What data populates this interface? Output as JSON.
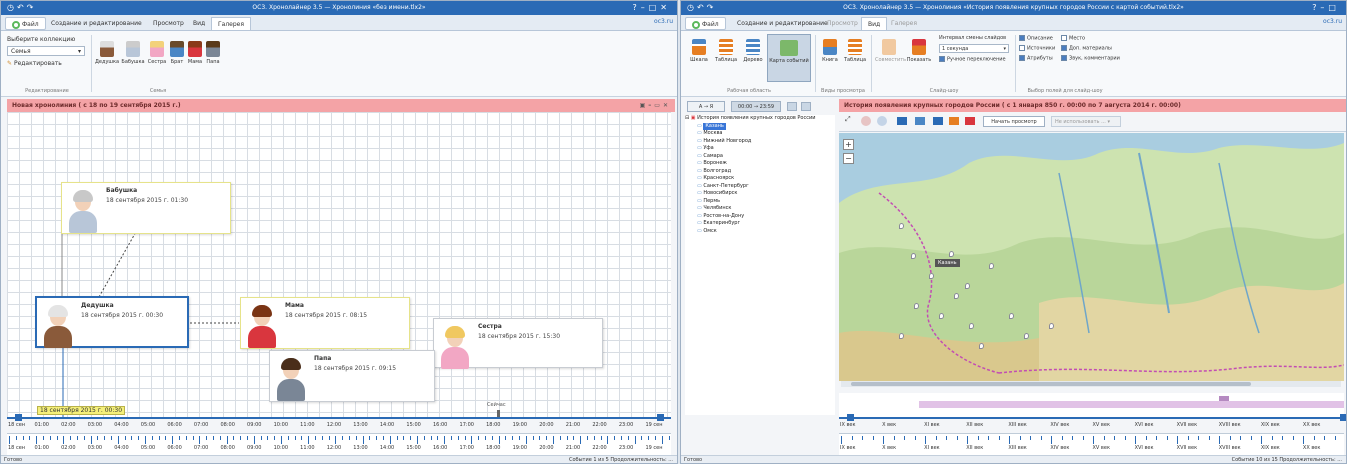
{
  "left": {
    "title": "ОС3. Хронолайнер 3.5 — Хронолиния «без имени.tlx2»",
    "site": "oc3.ru",
    "tabs": [
      "Файл",
      "Создание и редактирование",
      "Просмотр",
      "Вид",
      "Галерея"
    ],
    "ribbon": {
      "collection_label": "Выберите коллекцию",
      "collection_value": "Семья",
      "edit_label": "Редактировать",
      "group_edit": "Редактирование",
      "group_family": "Семья",
      "family_buttons": [
        "Дедушка",
        "Бабушка",
        "Сестра",
        "Брат",
        "Мама",
        "Папа"
      ]
    },
    "chrono_title": "Новая хронолиния ( с 18 по 19 сентября 2015 г.)",
    "cards": [
      {
        "name": "Бабушка",
        "date": "18 сентября 2015 г. 01:30"
      },
      {
        "name": "Дедушка",
        "date": "18 сентября 2015 г. 00:30"
      },
      {
        "name": "Мама",
        "date": "18 сентября 2015 г. 08:15"
      },
      {
        "name": "Сестра",
        "date": "18 сентября 2015 г. 15:30"
      },
      {
        "name": "Папа",
        "date": "18 сентября 2015 г. 09:15"
      }
    ],
    "cursor_date": "18 сентября 2015 г. 00:30",
    "now_label": "Сейчас",
    "axis": [
      "18 сен",
      "01:00",
      "02:00",
      "03:00",
      "04:00",
      "05:00",
      "06:00",
      "07:00",
      "08:00",
      "09:00",
      "10:00",
      "11:00",
      "12:00",
      "13:00",
      "14:00",
      "15:00",
      "16:00",
      "17:00",
      "18:00",
      "19:00",
      "20:00",
      "21:00",
      "22:00",
      "23:00",
      "19 сен"
    ],
    "status_left": "Готово",
    "status_right": "Событие 1 из 5  Продолжительность: ..."
  },
  "right": {
    "title": "ОС3. Хронолайнер 3.5 — Хронолиния «История появления крупных городов России с картой событий.tlx2»",
    "site": "oc3.ru",
    "tabs": [
      "Файл",
      "Создание и редактирование",
      "Просмотр",
      "Вид",
      "Галерея"
    ],
    "ribbon": {
      "work_buttons": [
        "Шкала",
        "Таблица",
        "Дерево",
        "Карта событий"
      ],
      "group_work": "Рабочая область",
      "view_buttons": [
        "Книга",
        "Таблица",
        "Совместить",
        "Показать"
      ],
      "group_views": "Виды просмотра",
      "group_slideshow": "Слайд-шоу",
      "interval_label": "Интервал смены слайдов",
      "interval_value": "1 секунда",
      "manual_label": "Ручное переключение",
      "checkboxes": [
        "Описание",
        "Место",
        "Источники",
        "Доп. материалы",
        "Атрибуты",
        "Звук, комментарии"
      ],
      "group_fields": "Выбор полей для слайд-шоу"
    },
    "sort_button": "А → Я",
    "time_button": "00:00 → 23:59",
    "chrono_title": "История появления крупных городов России ( с 1 января 850 г. 00:00 по 7 августа 2014 г. 00:00)",
    "start_view": "Начать просмотр",
    "map_mode": "Не использовать ...",
    "tree_root": "История появления крупных городов России",
    "cities": [
      "Казань",
      "Москва",
      "Нижний Новгород",
      "Уфа",
      "Самара",
      "Воронеж",
      "Волгоград",
      "Красноярск",
      "Санкт-Петербург",
      "Новосибирск",
      "Пермь",
      "Челябинск",
      "Ростов-на-Дону",
      "Екатеринбург",
      "Омск"
    ],
    "map_tooltip": "Казань",
    "axis": [
      "IX век",
      "X век",
      "XI век",
      "XII век",
      "XIII век",
      "XIV век",
      "XV век",
      "XVI век",
      "XVII век",
      "XVIII век",
      "XIX век",
      "XX век"
    ],
    "status_left": "Готово",
    "status_right": "Событие 10 из 15  Продолжительность: ..."
  }
}
